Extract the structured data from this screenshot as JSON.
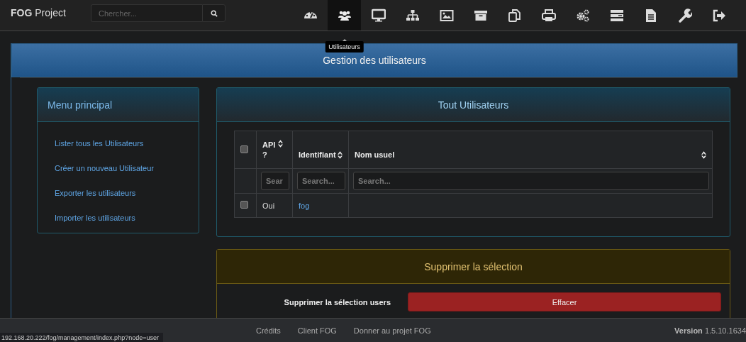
{
  "navbar": {
    "brand_bold": "FOG",
    "brand_rest": "Project",
    "search": {
      "placeholder": "Chercher..."
    },
    "items": [
      {
        "kind": "dashboard",
        "selected": false
      },
      {
        "kind": "users",
        "selected": true,
        "tooltip": "Utilisateurs"
      },
      {
        "kind": "desktop",
        "selected": false
      },
      {
        "kind": "sitemap",
        "selected": false
      },
      {
        "kind": "image",
        "selected": false
      },
      {
        "kind": "archive",
        "selected": false
      },
      {
        "kind": "copy",
        "selected": false
      },
      {
        "kind": "print",
        "selected": false
      },
      {
        "kind": "cogs",
        "selected": false
      },
      {
        "kind": "server",
        "selected": false
      },
      {
        "kind": "file",
        "selected": false
      },
      {
        "kind": "wrench",
        "selected": false
      },
      {
        "kind": "signout",
        "selected": false
      }
    ]
  },
  "page_title": "Gestion des utilisateurs",
  "sidebar": {
    "title": "Menu principal",
    "items": [
      "Lister tous les Utilisateurs",
      "Créer un nouveau Utilisateur",
      "Exporter les utilisateurs",
      "Importer les utilisateurs"
    ]
  },
  "users_panel": {
    "title": "Tout Utilisateurs",
    "table": {
      "select_all_checked": false,
      "columns": [
        {
          "label": "API ?",
          "sortable": true
        },
        {
          "label": "Identifiant",
          "sortable": true
        },
        {
          "label": "Nom usuel",
          "sortable": true
        }
      ],
      "filters": [
        {
          "placeholder": "Sear"
        },
        {
          "placeholder": "Search..."
        },
        {
          "placeholder": "Search..."
        }
      ],
      "rows": [
        {
          "checked": false,
          "api": "Oui",
          "identifiant": "fog"
        }
      ]
    }
  },
  "delete_panel": {
    "title": "Supprimer la sélection",
    "label": "Supprimer la sélection users",
    "button": "Effacer"
  },
  "footer": {
    "links": [
      "Crédits",
      "Client FOG",
      "Donner au projet FOG"
    ],
    "version_label": "Version",
    "version": "1.5.10.1634"
  },
  "status_url": "192.168.20.222/fog/management/index.php?node=user"
}
